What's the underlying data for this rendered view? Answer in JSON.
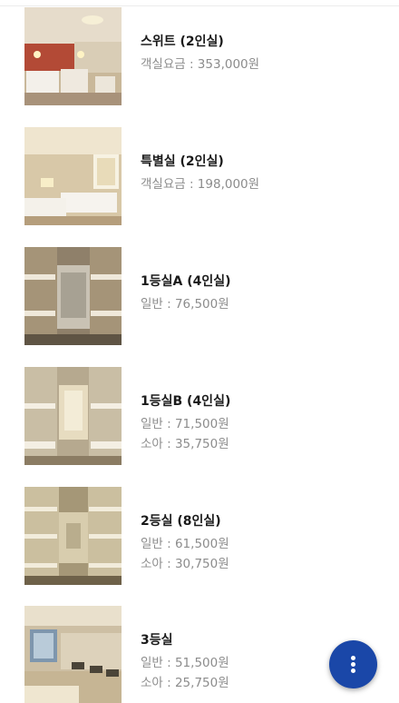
{
  "rooms": [
    {
      "name": "스위트 (2인실)",
      "prices": [
        "객실요금 : 353,000원"
      ],
      "photo": "suite-room-photo"
    },
    {
      "name": "특별실 (2인실)",
      "prices": [
        "객실요금 : 198,000원"
      ],
      "photo": "special-room-photo"
    },
    {
      "name": "1등실A (4인실)",
      "prices": [
        "일반 : 76,500원"
      ],
      "photo": "first-class-a-room-photo"
    },
    {
      "name": "1등실B (4인실)",
      "prices": [
        "일반 : 71,500원",
        "소아 : 35,750원"
      ],
      "photo": "first-class-b-room-photo"
    },
    {
      "name": "2등실 (8인실)",
      "prices": [
        "일반 : 61,500원",
        "소아 : 30,750원"
      ],
      "photo": "second-class-room-photo"
    },
    {
      "name": "3등실",
      "prices": [
        "일반 : 51,500원",
        "소아 : 25,750원"
      ],
      "photo": "third-class-room-photo"
    }
  ],
  "fab": {
    "icon": "more-vertical-icon",
    "color": "#1a47a8"
  }
}
